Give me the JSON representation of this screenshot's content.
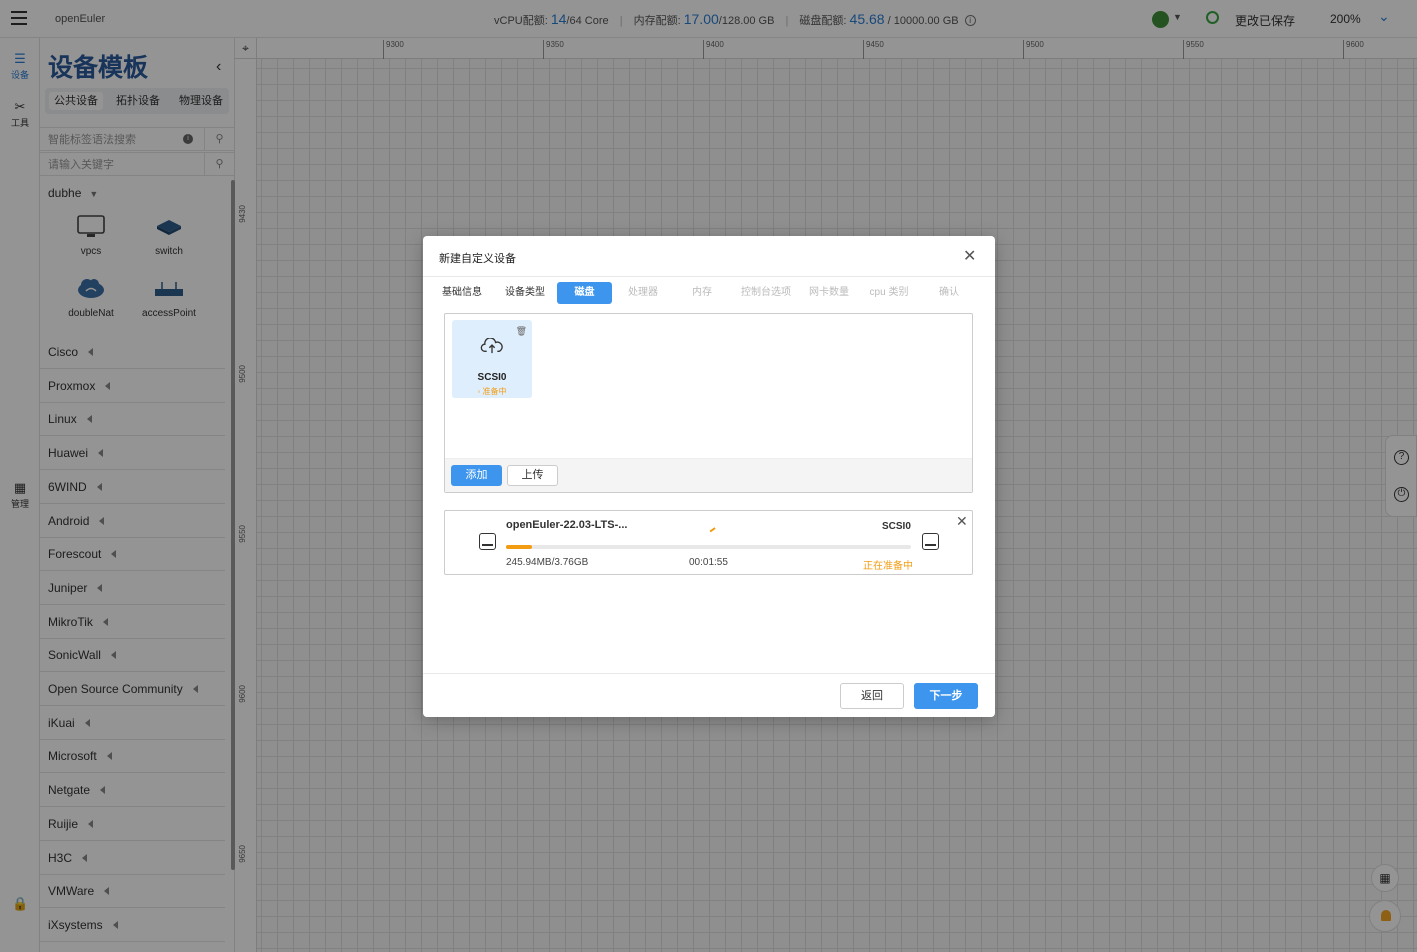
{
  "topbar": {
    "app_name": "openEuler",
    "vcpu_label": "vCPU配额:",
    "vcpu_used": "14",
    "vcpu_total": "/64 Core",
    "mem_label": "内存配额:",
    "mem_used": "17.00",
    "mem_total": "/128.00 GB",
    "disk_label": "磁盘配额:",
    "disk_used": "45.68",
    "disk_total": "/ 10000.00 GB",
    "save_status": "更改已保存",
    "zoom": "200%"
  },
  "rail": {
    "devices": "设备",
    "tools": "工具",
    "manage": "管理"
  },
  "panel": {
    "title": "设备模板",
    "tabs": [
      "公共设备",
      "拓扑设备",
      "物理设备"
    ],
    "tag_search_placeholder": "智能标签语法搜索",
    "keyword_placeholder": "请输入关键字",
    "open_group": "dubhe",
    "devices": [
      "vpcs",
      "switch",
      "doubleNat",
      "accessPoint"
    ],
    "vendors": [
      "Cisco",
      "Proxmox",
      "Linux",
      "Huawei",
      "6WIND",
      "Android",
      "Forescout",
      "Juniper",
      "MikroTik",
      "SonicWall",
      "Open Source Community",
      "iKuai",
      "Microsoft",
      "Netgate",
      "Ruijie",
      "H3C",
      "VMWare",
      "iXsystems"
    ]
  },
  "ruler": {
    "h": [
      "9300",
      "9350",
      "9400",
      "9450",
      "9500",
      "9550",
      "9600"
    ],
    "v": [
      "9430",
      "9500",
      "9550",
      "9600",
      "9650"
    ]
  },
  "modal": {
    "title": "新建自定义设备",
    "steps": [
      "基础信息",
      "设备类型",
      "磁盘",
      "处理器",
      "内存",
      "控制台选项",
      "网卡数量",
      "cpu 类别",
      "确认"
    ],
    "active_step": "磁盘",
    "disk_card": {
      "name": "SCSI0",
      "status": "准备中"
    },
    "add_button": "添加",
    "upload_button": "上传",
    "upload": {
      "file_name": "openEuler-22.03-LTS-...",
      "disk": "SCSI0",
      "progress": 0.065,
      "size": "245.94MB/3.76GB",
      "elapsed": "00:01:55",
      "state": "正在准备中"
    },
    "back_button": "返回",
    "next_button": "下一步"
  },
  "colors": {
    "accent": "#3d95ee",
    "title_blue": "#2b5a9c",
    "warning": "#f39c12",
    "saved": "#37a644"
  }
}
